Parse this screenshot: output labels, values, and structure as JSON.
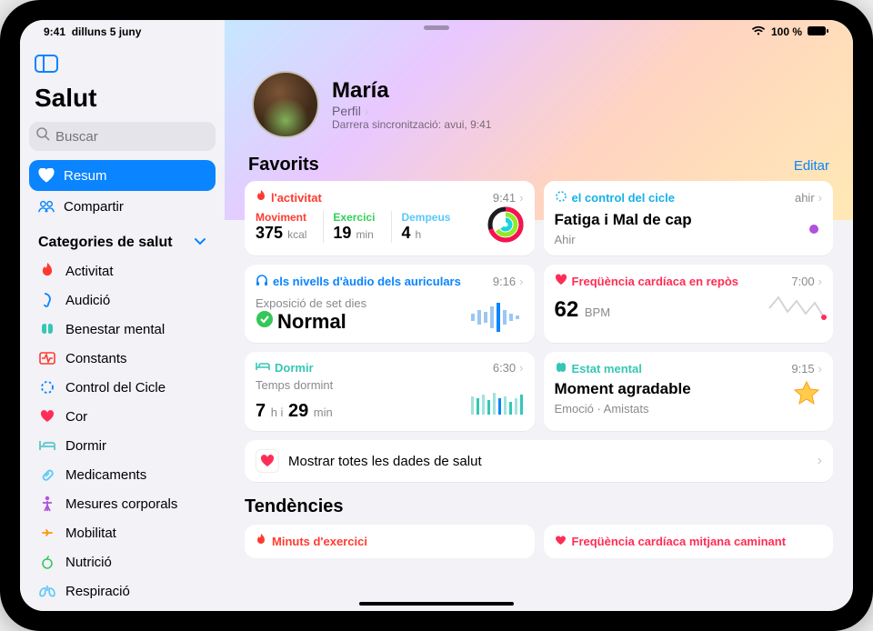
{
  "statusbar": {
    "time": "9:41",
    "date": "dilluns 5 juny",
    "battery": "100 %"
  },
  "app": {
    "title": "Salut"
  },
  "search": {
    "placeholder": "Buscar"
  },
  "sidebar": {
    "summary": "Resum",
    "share": "Compartir",
    "categories_header": "Categories de salut",
    "categories": [
      {
        "label": "Activitat",
        "color": "#ff3b30",
        "glyph": "flame"
      },
      {
        "label": "Audició",
        "color": "#0a84ff",
        "glyph": "ear"
      },
      {
        "label": "Benestar mental",
        "color": "#34c7b5",
        "glyph": "brain"
      },
      {
        "label": "Constants",
        "color": "#ff3b30",
        "glyph": "vitals"
      },
      {
        "label": "Control del Cicle",
        "color": "#0a84ff",
        "glyph": "cycle"
      },
      {
        "label": "Cor",
        "color": "#ff2d55",
        "glyph": "heart"
      },
      {
        "label": "Dormir",
        "color": "#5ac8c8",
        "glyph": "bed"
      },
      {
        "label": "Medicaments",
        "color": "#5ac8fa",
        "glyph": "pill"
      },
      {
        "label": "Mesures corporals",
        "color": "#af52de",
        "glyph": "body"
      },
      {
        "label": "Mobilitat",
        "color": "#ff9500",
        "glyph": "mobility"
      },
      {
        "label": "Nutrició",
        "color": "#34c759",
        "glyph": "apple"
      },
      {
        "label": "Respiració",
        "color": "#5ac8fa",
        "glyph": "lungs"
      }
    ]
  },
  "profile": {
    "name": "María",
    "link": "Perfil",
    "sync_prefix": "Darrera sincronització:",
    "sync_value": "avui, 9:41"
  },
  "favorites": {
    "title": "Favorits",
    "edit": "Editar",
    "activity": {
      "title": "l'activitat",
      "time": "9:41",
      "color": "#ff3b30",
      "move_label": "Moviment",
      "move_value": "375",
      "move_unit": "kcal",
      "exercise_label": "Exercici",
      "exercise_value": "19",
      "exercise_unit": "min",
      "stand_label": "Dempeus",
      "stand_value": "4",
      "stand_unit": "h"
    },
    "cycle": {
      "title": "el control del cicle",
      "time": "ahir",
      "color": "#17b1e7",
      "headline": "Fatiga i Mal de cap",
      "sub": "Ahir"
    },
    "headphones": {
      "title": "els nivells d'àudio dels auriculars",
      "time": "9:16",
      "color": "#0a84ff",
      "sub": "Exposició de set dies",
      "status": "Normal"
    },
    "heart": {
      "title": "Freqüència cardíaca en repòs",
      "time": "7:00",
      "color": "#ff2d55",
      "value": "62",
      "unit": "BPM"
    },
    "sleep": {
      "title": "Dormir",
      "time": "6:30",
      "color": "#34c7b5",
      "sub": "Temps dormint",
      "hours": "7",
      "h_unit": "h i",
      "minutes": "29",
      "m_unit": "min"
    },
    "mental": {
      "title": "Estat mental",
      "time": "9:15",
      "color": "#34c7b5",
      "headline": "Moment agradable",
      "sub": "Emoció · Amistats"
    },
    "show_all": "Mostrar totes les dades de salut"
  },
  "trends": {
    "title": "Tendències",
    "left": "Minuts d'exercici",
    "right": "Freqüència cardíaca mitjana caminant"
  }
}
